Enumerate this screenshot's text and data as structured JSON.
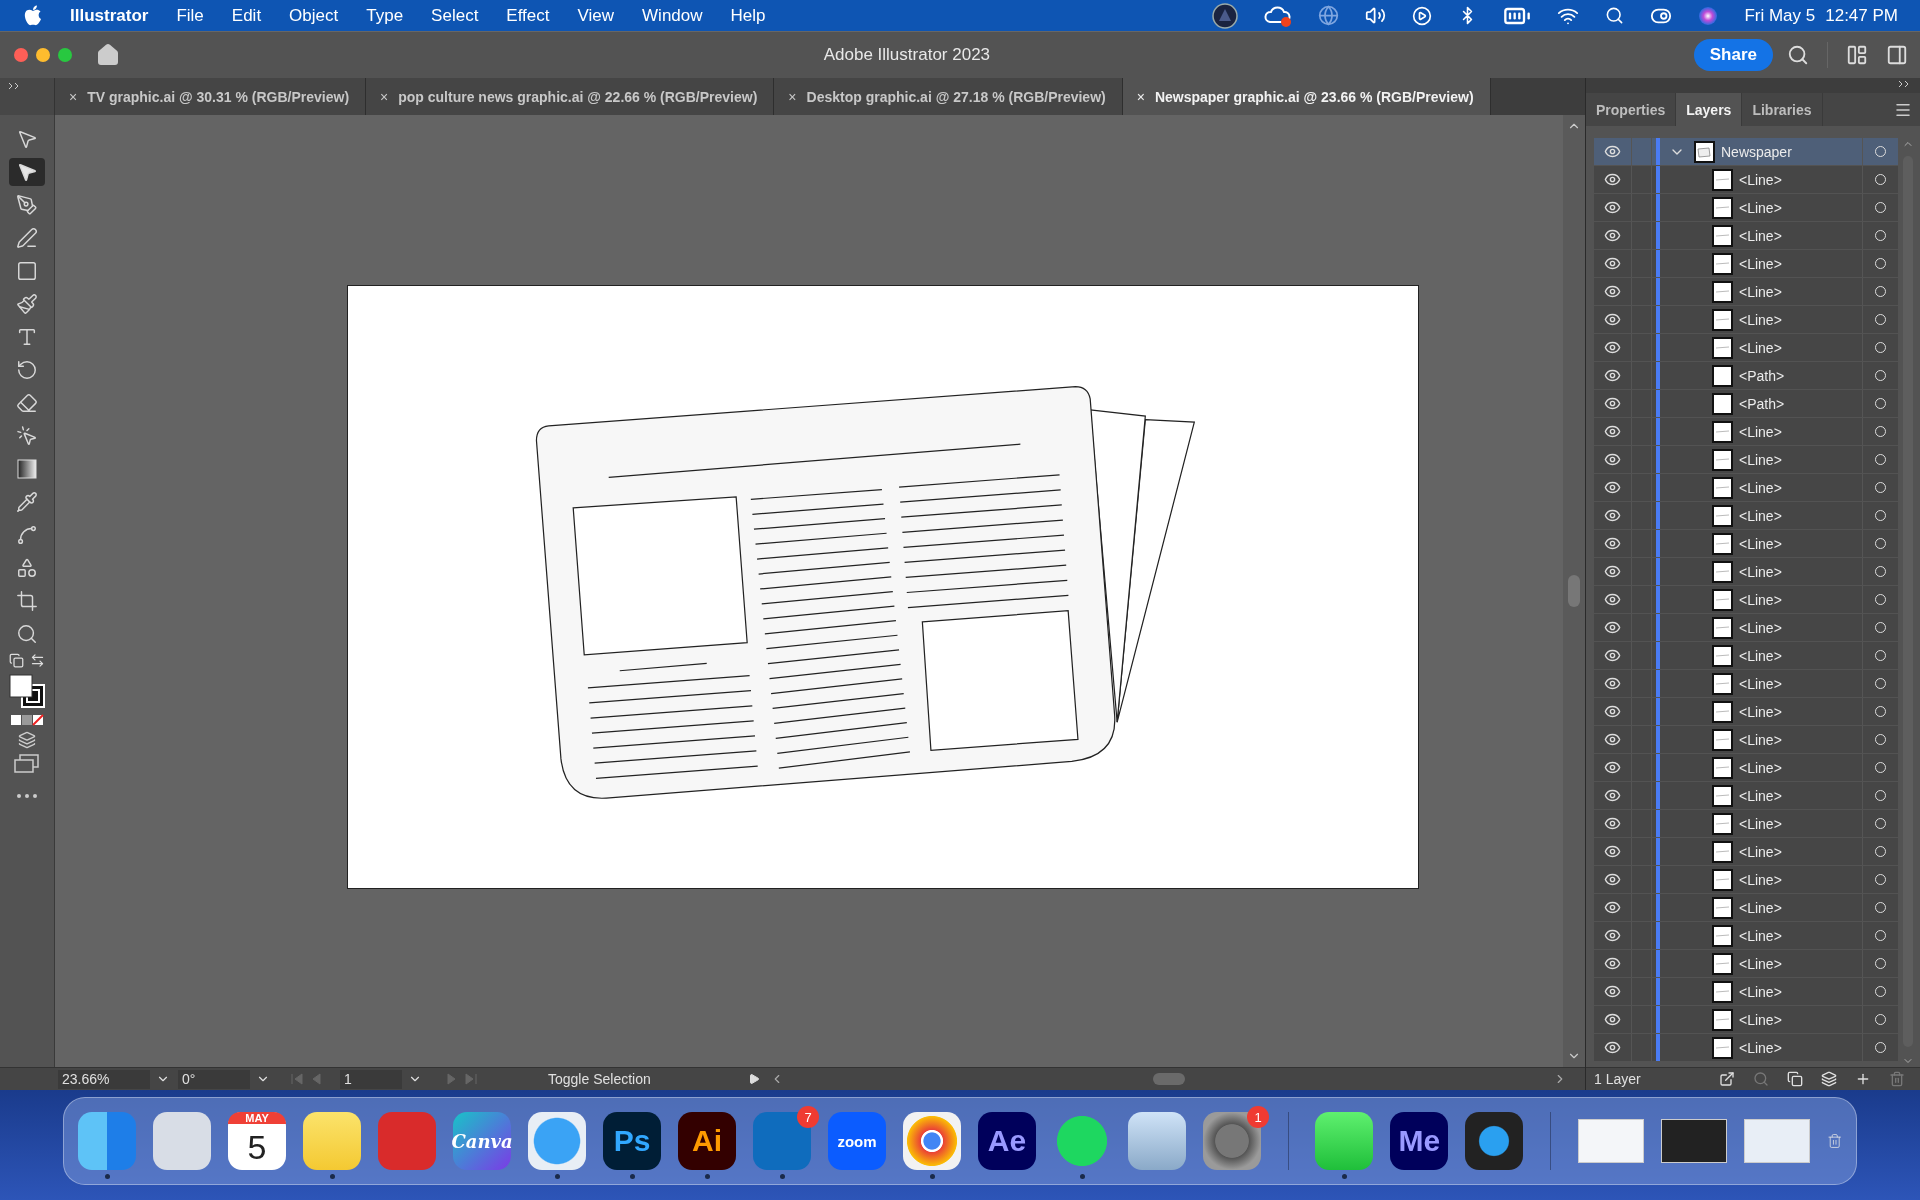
{
  "menu_bar": {
    "app": "Illustrator",
    "menus": [
      "File",
      "Edit",
      "Object",
      "Type",
      "Select",
      "Effect",
      "View",
      "Window",
      "Help"
    ],
    "date": "Fri May 5",
    "time": "12:47 PM"
  },
  "window": {
    "title": "Adobe Illustrator 2023",
    "share": "Share"
  },
  "document_tabs": [
    {
      "close": "×",
      "label": "TV graphic.ai @ 30.31 % (RGB/Preview)",
      "selected": false
    },
    {
      "close": "×",
      "label": "pop culture news graphic.ai @ 22.66 % (RGB/Preview)",
      "selected": false
    },
    {
      "close": "×",
      "label": "Desktop graphic.ai @ 27.18 % (RGB/Preview)",
      "selected": false
    },
    {
      "close": "×",
      "label": "Newspaper graphic.ai @ 23.66 % (RGB/Preview)",
      "selected": true
    }
  ],
  "tools": [
    {
      "selected": false
    },
    {
      "selected": true
    },
    {
      "selected": false
    },
    {
      "selected": false
    },
    {
      "selected": false
    },
    {
      "selected": false
    },
    {
      "selected": false
    },
    {
      "selected": false
    },
    {
      "selected": false
    },
    {
      "selected": false
    },
    {
      "selected": false
    },
    {
      "selected": false
    },
    {
      "selected": false
    },
    {
      "selected": false
    },
    {
      "selected": false
    },
    {
      "selected": false
    }
  ],
  "panel": {
    "tabs": [
      {
        "label": "Properties",
        "selected": false
      },
      {
        "label": "Layers",
        "selected": true
      },
      {
        "label": "Libraries",
        "selected": false
      }
    ],
    "layers": [
      {
        "name": "Newspaper",
        "kind": "layer",
        "visible": true,
        "selected": true,
        "expanded": true,
        "children": [
          {
            "name": "<Line>",
            "kind": "line",
            "visible": true,
            "selected": false
          },
          {
            "name": "<Line>",
            "kind": "line",
            "visible": true,
            "selected": false
          },
          {
            "name": "<Line>",
            "kind": "line",
            "visible": true,
            "selected": false
          },
          {
            "name": "<Line>",
            "kind": "line",
            "visible": true,
            "selected": false
          },
          {
            "name": "<Line>",
            "kind": "line",
            "visible": true,
            "selected": false
          },
          {
            "name": "<Line>",
            "kind": "line",
            "visible": true,
            "selected": false
          },
          {
            "name": "<Line>",
            "kind": "line",
            "visible": true,
            "selected": false
          },
          {
            "name": "<Path>",
            "kind": "path",
            "visible": true,
            "selected": false
          },
          {
            "name": "<Path>",
            "kind": "path",
            "visible": true,
            "selected": false
          },
          {
            "name": "<Line>",
            "kind": "line",
            "visible": true,
            "selected": false
          },
          {
            "name": "<Line>",
            "kind": "line",
            "visible": true,
            "selected": false
          },
          {
            "name": "<Line>",
            "kind": "line",
            "visible": true,
            "selected": false
          },
          {
            "name": "<Line>",
            "kind": "line",
            "visible": true,
            "selected": false
          },
          {
            "name": "<Line>",
            "kind": "line",
            "visible": true,
            "selected": false
          },
          {
            "name": "<Line>",
            "kind": "line",
            "visible": true,
            "selected": false
          },
          {
            "name": "<Line>",
            "kind": "line",
            "visible": true,
            "selected": false
          },
          {
            "name": "<Line>",
            "kind": "line",
            "visible": true,
            "selected": false
          },
          {
            "name": "<Line>",
            "kind": "line",
            "visible": true,
            "selected": false
          },
          {
            "name": "<Line>",
            "kind": "line",
            "visible": true,
            "selected": false
          },
          {
            "name": "<Line>",
            "kind": "line",
            "visible": true,
            "selected": false
          },
          {
            "name": "<Line>",
            "kind": "line",
            "visible": true,
            "selected": false
          },
          {
            "name": "<Line>",
            "kind": "line",
            "visible": true,
            "selected": false
          },
          {
            "name": "<Line>",
            "kind": "line",
            "visible": true,
            "selected": false
          },
          {
            "name": "<Line>",
            "kind": "line",
            "visible": true,
            "selected": false
          },
          {
            "name": "<Line>",
            "kind": "line",
            "visible": true,
            "selected": false
          },
          {
            "name": "<Line>",
            "kind": "line",
            "visible": true,
            "selected": false
          },
          {
            "name": "<Line>",
            "kind": "line",
            "visible": true,
            "selected": false
          },
          {
            "name": "<Line>",
            "kind": "line",
            "visible": true,
            "selected": false
          },
          {
            "name": "<Line>",
            "kind": "line",
            "visible": true,
            "selected": false
          },
          {
            "name": "<Line>",
            "kind": "line",
            "visible": true,
            "selected": false
          },
          {
            "name": "<Line>",
            "kind": "line",
            "visible": true,
            "selected": false
          },
          {
            "name": "<Line>",
            "kind": "line",
            "visible": true,
            "selected": false
          }
        ]
      }
    ],
    "footer": "1 Layer"
  },
  "status_bar": {
    "zoom": "23.66%",
    "rotation": "0°",
    "artboard": "1",
    "action": "Toggle Selection"
  },
  "dock": [
    {
      "kind": "app",
      "running": true
    },
    {
      "kind": "app",
      "running": false
    },
    {
      "kind": "calendar",
      "month": "MAY",
      "day": "5",
      "running": false
    },
    {
      "kind": "app",
      "running": true
    },
    {
      "kind": "app",
      "running": false
    },
    {
      "kind": "app",
      "label": "Canva",
      "running": false
    },
    {
      "kind": "app",
      "running": true
    },
    {
      "kind": "app",
      "label": "Ps",
      "running": true
    },
    {
      "kind": "app",
      "label": "Ai",
      "running": true
    },
    {
      "kind": "app",
      "badge": "7",
      "running": true
    },
    {
      "kind": "app",
      "label": "zoom",
      "running": false
    },
    {
      "kind": "app",
      "running": true
    },
    {
      "kind": "app",
      "label": "Ae",
      "running": false
    },
    {
      "kind": "app",
      "running": true
    },
    {
      "kind": "app",
      "running": false
    },
    {
      "kind": "app",
      "badge": "1",
      "running": false
    },
    {
      "kind": "separator"
    },
    {
      "kind": "app",
      "running": true
    },
    {
      "kind": "app",
      "label": "Me",
      "running": false
    },
    {
      "kind": "app",
      "running": false
    },
    {
      "kind": "separator"
    },
    {
      "kind": "window"
    },
    {
      "kind": "window"
    },
    {
      "kind": "window"
    },
    {
      "kind": "trash"
    }
  ]
}
